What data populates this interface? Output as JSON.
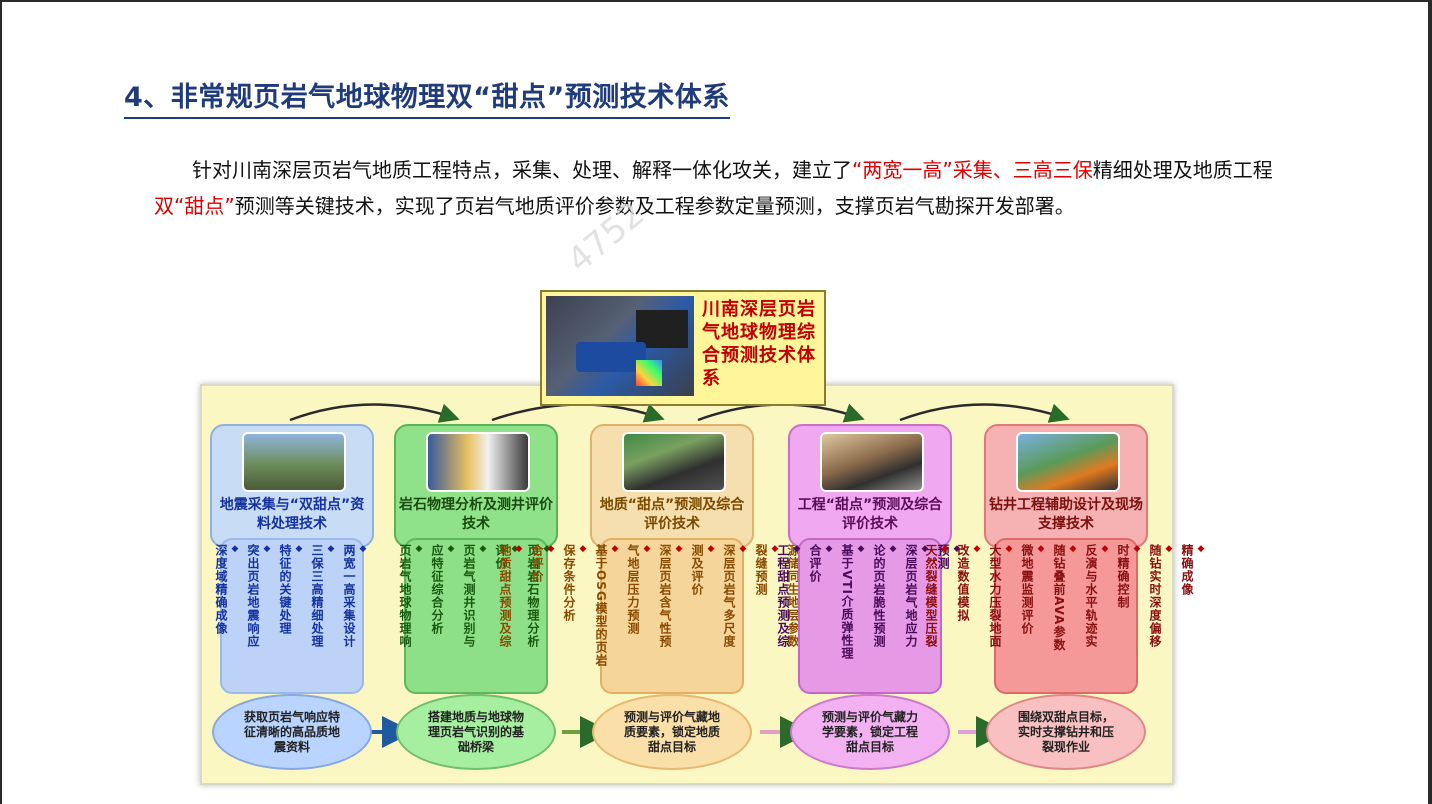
{
  "title": "4、非常规页岩气地球物理双“甜点”预测技术体系",
  "paragraph": {
    "p1": "针对川南深层页岩气地质工程特点，采集、处理、解释一体化攻关，建立了",
    "r1": "“两宽一高”采集、三高三保",
    "p2": "精细处理及地质工程",
    "r2": "双“甜点”",
    "p3": "预测等关键技术，实现了页岩气地质评价参数及工程参数定量预测，支撑页岩气勘探开发部署。"
  },
  "watermark": "4752",
  "top_box": "川南深层页岩气地球物理综合预测技术体系",
  "columns": [
    {
      "header": "地震采集与“双甜点”资料处理技术",
      "items": [
        "两宽一高采集设计",
        "三保三高精细处理",
        "特征的关键处理",
        "突出页岩地震响应",
        "深度域精确成像"
      ],
      "outcome": "获取页岩气响应特征清晰的高品质地震资料",
      "bullet_color": "#1433a0"
    },
    {
      "header": "岩石物理分析及测井评价技术",
      "items": [
        "页岩岩石物理分析",
        "评价",
        "页岩气测井识别与",
        "应特征综合分析",
        "页岩气地球物理响"
      ],
      "outcome": "搭建地质与地球物理页岩气识别的基础桥梁",
      "bullet_color": "#185a10"
    },
    {
      "header": "地质“甜点”预测及综合评价技术",
      "items": [
        "定量预测",
        "源储同生地层参数",
        "裂缝预测",
        "深层页岩气多尺度",
        "测及评价",
        "深层页岩含气性预",
        "气地层压力预测",
        "基于OSG模型的页岩",
        "保存条件分析",
        "合评价",
        "地质甜点预测及综"
      ],
      "outcome": "预测与评价气藏地质要素，锁定地质甜点目标",
      "bullet_color": "#c00000"
    },
    {
      "header": "工程“甜点”预测及综合评价技术",
      "items": [
        "预测",
        "深层页岩气地应力",
        "论的页岩脆性预测",
        "基于VTI介质弹性理",
        "合评价",
        "工程甜点预测及综"
      ],
      "outcome": "预测与评价气藏力学要素，锁定工程甜点目标",
      "bullet_color": "#4a0a5a"
    },
    {
      "header": "钻井工程辅助设计及现场支撑技术",
      "items": [
        "精确成像",
        "随钻实时深度偏移",
        "时精确控制",
        "反演与水平轨迹实",
        "随钻叠前AVA参数",
        "微地震监测评价",
        "大型水力压裂地面",
        "改造数值模拟",
        "天然裂缝模型压裂"
      ],
      "outcome": "围绕双甜点目标，实时支撑钻井和压裂现作业",
      "bullet_color": "#c00000"
    }
  ]
}
